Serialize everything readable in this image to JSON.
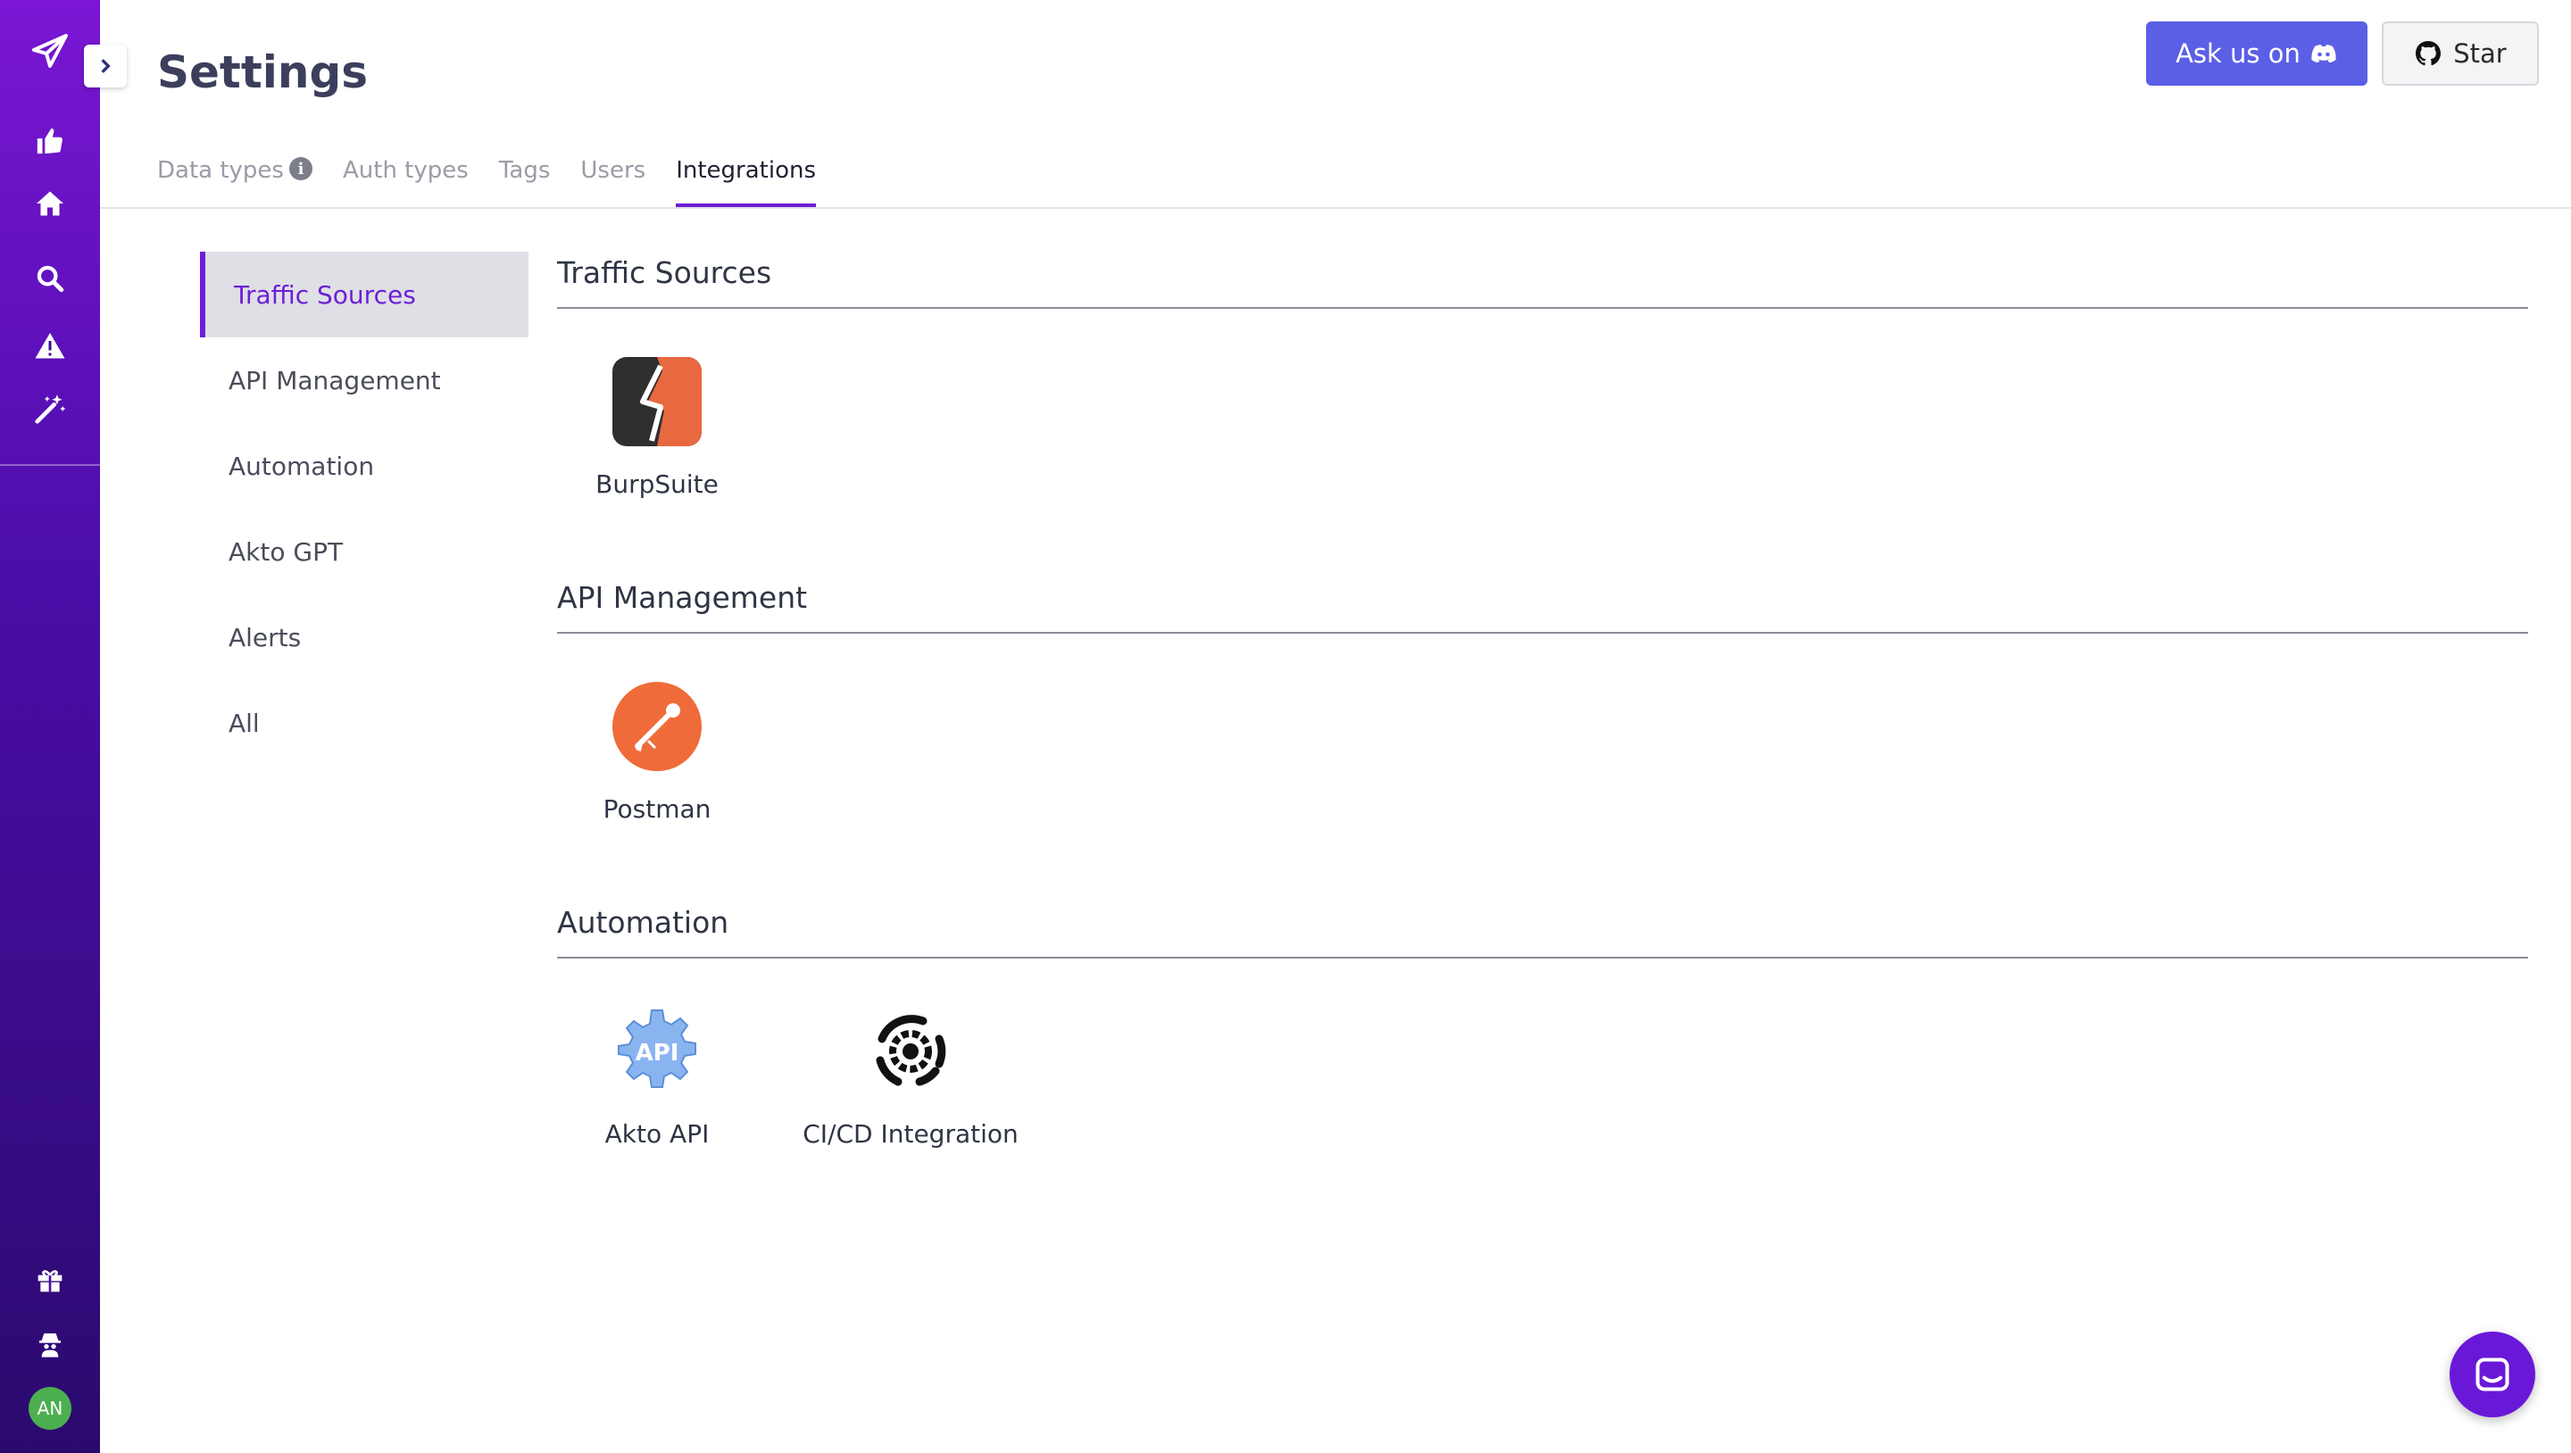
{
  "header": {
    "title": "Settings",
    "ask_label": "Ask us on",
    "star_label": "Star"
  },
  "tabs": [
    {
      "label": "Data types",
      "active": false
    },
    {
      "label": "Auth types",
      "active": false
    },
    {
      "label": "Tags",
      "active": false
    },
    {
      "label": "Users",
      "active": false
    },
    {
      "label": "Integrations",
      "active": true
    }
  ],
  "subnav": [
    {
      "label": "Traffic Sources",
      "active": true
    },
    {
      "label": "API Management",
      "active": false
    },
    {
      "label": "Automation",
      "active": false
    },
    {
      "label": "Akto GPT",
      "active": false
    },
    {
      "label": "Alerts",
      "active": false
    },
    {
      "label": "All",
      "active": false
    }
  ],
  "sections": [
    {
      "title": "Traffic Sources",
      "items": [
        {
          "label": "BurpSuite",
          "icon": "burpsuite-icon"
        }
      ]
    },
    {
      "title": "API Management",
      "items": [
        {
          "label": "Postman",
          "icon": "postman-icon"
        }
      ]
    },
    {
      "title": "Automation",
      "items": [
        {
          "label": "Akto API",
          "icon": "akto-api-icon"
        },
        {
          "label": "CI/CD Integration",
          "icon": "cicd-gear-icon"
        }
      ]
    }
  ],
  "avatar": {
    "initials": "AN"
  },
  "colors": {
    "accent": "#6c1fd6",
    "ask_button": "#5b5fe6",
    "burp": "#e8683f",
    "postman": "#ef6c3a",
    "avatar": "#4caf50"
  },
  "rail_icons": [
    "send-icon",
    "thumbs-up-icon",
    "home-icon",
    "search-icon",
    "alert-icon",
    "magic-wand-icon",
    "gift-icon",
    "spy-icon"
  ]
}
